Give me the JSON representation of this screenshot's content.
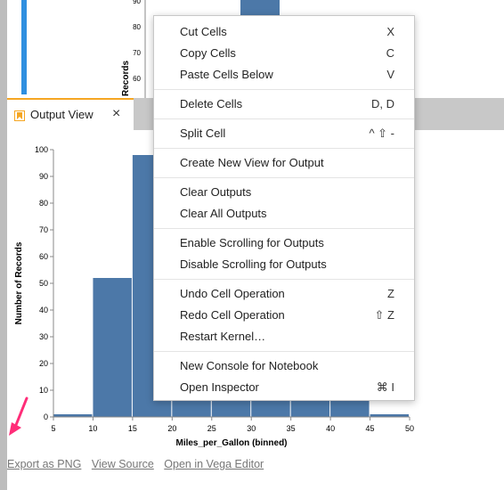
{
  "top_chart": {
    "ylabel": "Records",
    "ticks": [
      "90",
      "80",
      "70",
      "60"
    ]
  },
  "tab": {
    "label": "Output View",
    "close": "×"
  },
  "chart_data": {
    "type": "bar",
    "xlabel": "Miles_per_Gallon (binned)",
    "ylabel": "Number of Records",
    "bins": [
      {
        "x0": 5,
        "x1": 10,
        "value": 1
      },
      {
        "x0": 10,
        "x1": 15,
        "value": 52
      },
      {
        "x0": 15,
        "x1": 20,
        "value": 98
      },
      {
        "x0": 20,
        "x1": 25,
        "value": 98
      },
      {
        "x0": 25,
        "x1": 30,
        "value": 98
      },
      {
        "x0": 30,
        "x1": 35,
        "value": 98
      },
      {
        "x0": 35,
        "x1": 40,
        "value": 98
      },
      {
        "x0": 40,
        "x1": 45,
        "value": 10
      },
      {
        "x0": 45,
        "x1": 50,
        "value": 1
      }
    ],
    "xlim": [
      5,
      50
    ],
    "ylim": [
      0,
      100
    ],
    "xticks": [
      5,
      10,
      15,
      20,
      25,
      30,
      35,
      40,
      45,
      50
    ],
    "yticks": [
      0,
      10,
      20,
      30,
      40,
      50,
      60,
      70,
      80,
      90,
      100
    ],
    "bar_color": "#4c78a8"
  },
  "links": [
    "Export as PNG",
    "View Source",
    "Open in Vega Editor"
  ],
  "menu": {
    "groups": [
      [
        {
          "label": "Cut Cells",
          "shortcut": "X"
        },
        {
          "label": "Copy Cells",
          "shortcut": "C"
        },
        {
          "label": "Paste Cells Below",
          "shortcut": "V"
        }
      ],
      [
        {
          "label": "Delete Cells",
          "shortcut": "D, D"
        }
      ],
      [
        {
          "label": "Split Cell",
          "shortcut": "^ ⇧ -"
        }
      ],
      [
        {
          "label": "Create New View for Output",
          "shortcut": ""
        }
      ],
      [
        {
          "label": "Clear Outputs",
          "shortcut": ""
        },
        {
          "label": "Clear All Outputs",
          "shortcut": ""
        }
      ],
      [
        {
          "label": "Enable Scrolling for Outputs",
          "shortcut": ""
        },
        {
          "label": "Disable Scrolling for Outputs",
          "shortcut": ""
        }
      ],
      [
        {
          "label": "Undo Cell Operation",
          "shortcut": "Z"
        },
        {
          "label": "Redo Cell Operation",
          "shortcut": "⇧ Z"
        },
        {
          "label": "Restart Kernel…",
          "shortcut": ""
        }
      ],
      [
        {
          "label": "New Console for Notebook",
          "shortcut": ""
        },
        {
          "label": "Open Inspector",
          "shortcut": "⌘ I"
        }
      ]
    ]
  },
  "colors": {
    "accent": "#2f8fe0",
    "arrow": "#ff2d78",
    "tab_icon": "#f5a623"
  }
}
